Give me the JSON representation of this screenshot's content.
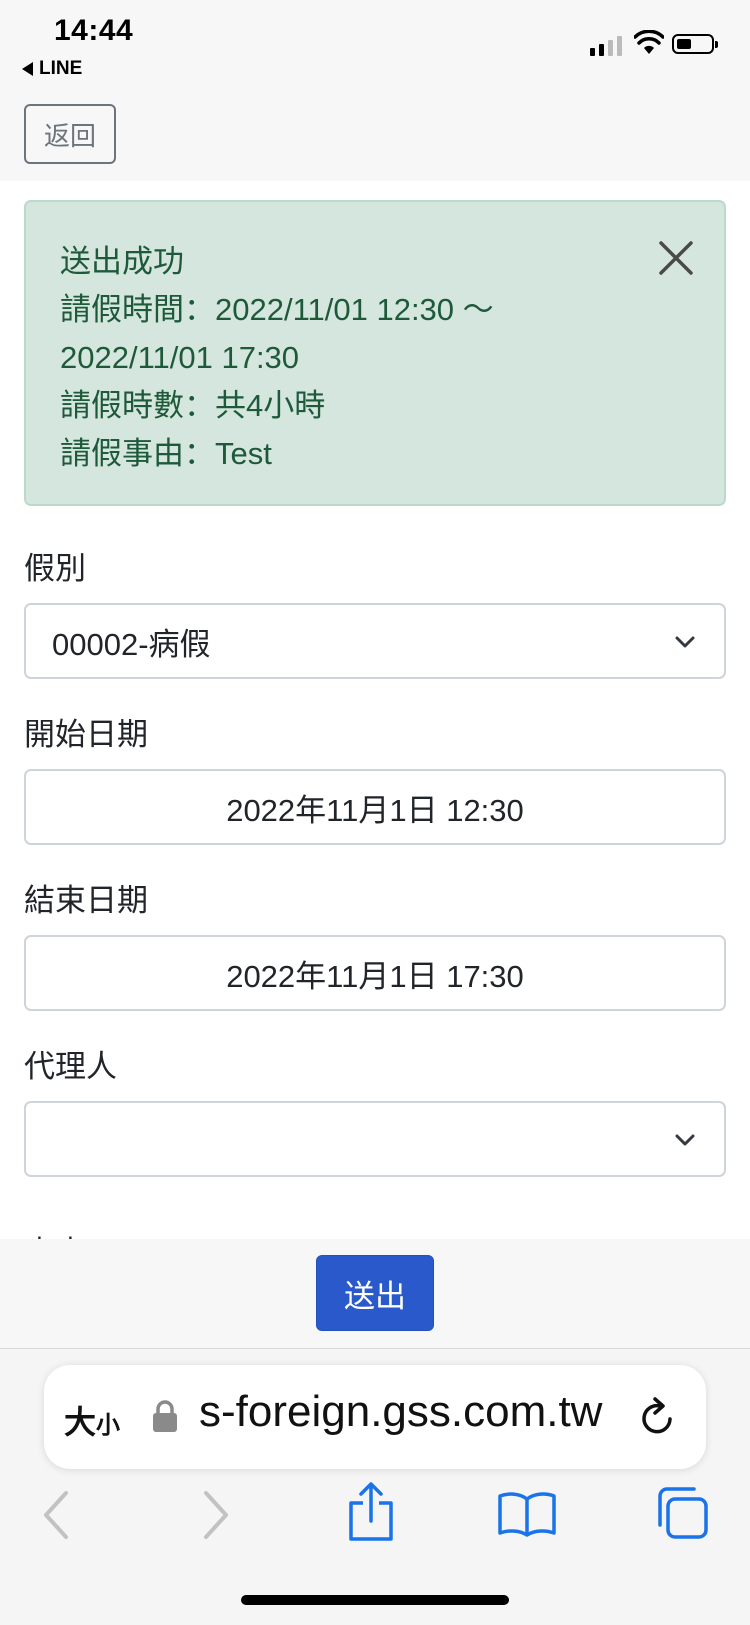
{
  "status_bar": {
    "time": "14:44",
    "back_app": "LINE"
  },
  "back_button": {
    "label": "返回"
  },
  "alert": {
    "lines": [
      "送出成功",
      "請假時間：2022/11/01 12:30 ～",
      "2022/11/01 17:30",
      "請假時數：共4小時",
      "請假事由：Test"
    ]
  },
  "form": {
    "leave_type": {
      "label": "假別",
      "value": "00002-病假"
    },
    "start_date": {
      "label": "開始日期",
      "value": "2022年11月1日 12:30"
    },
    "end_date": {
      "label": "結束日期",
      "value": "2022年11月1日 17:30"
    },
    "agent": {
      "label": "代理人",
      "value": ""
    },
    "reason": {
      "label": "事由"
    }
  },
  "submit_button": {
    "label": "送出"
  },
  "safari": {
    "text_size_label_big": "大",
    "text_size_label_small": "小",
    "url": "s-foreign.gss.com.tw"
  },
  "colors": {
    "alert_bg": "#d4e6dd",
    "alert_text": "#1e5a3a",
    "primary": "#2a59cc",
    "ios_blue": "#1a73e8"
  }
}
